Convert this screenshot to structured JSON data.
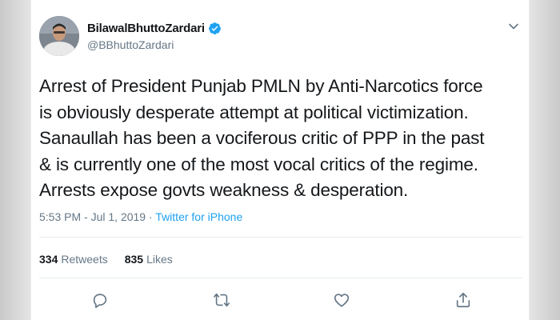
{
  "tweet": {
    "author": {
      "display_name": "BilawalBhuttoZardari",
      "handle": "@BBhuttoZardari",
      "verified": true
    },
    "text": "Arrest of President Punjab PMLN by Anti-Narcotics force\nis obviously desperate attempt at political victimization.\nSanaullah has been a vociferous critic of PPP in the past\n& is currently one of the most vocal critics of the regime.\nArrests expose govts weakness & desperation.",
    "time": "5:53 PM",
    "separator": "·",
    "date": "Jul 1, 2019",
    "source": "Twitter for iPhone",
    "stats": {
      "retweets_count": "334",
      "retweets_label": "Retweets",
      "likes_count": "835",
      "likes_label": "Likes"
    },
    "actions": [
      "reply-icon",
      "retweet-icon",
      "like-icon",
      "share-icon"
    ]
  },
  "colors": {
    "text_primary": "#14171a",
    "text_secondary": "#657786",
    "brand_blue": "#1da1f2",
    "divider": "#e6ecf0"
  }
}
